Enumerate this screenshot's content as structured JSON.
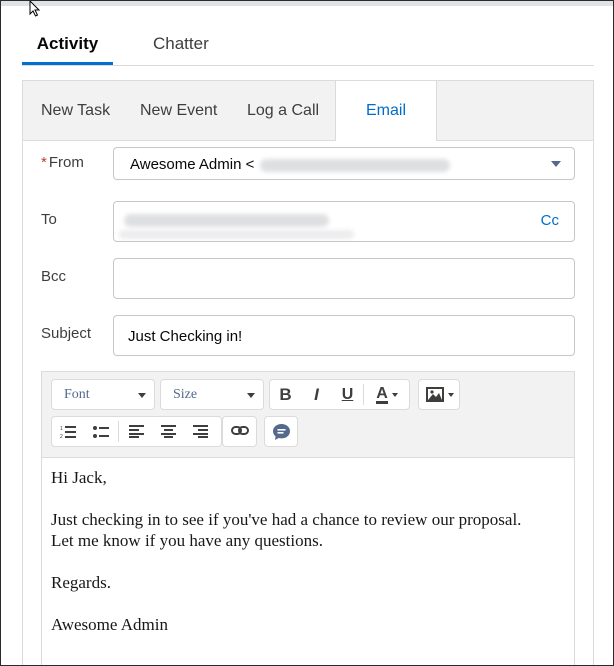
{
  "main_tabs": [
    {
      "label": "Activity",
      "active": true
    },
    {
      "label": "Chatter",
      "active": false
    }
  ],
  "publisher_tabs": [
    {
      "label": "New Task"
    },
    {
      "label": "New Event"
    },
    {
      "label": "Log a Call"
    },
    {
      "label": "Email",
      "active": true
    }
  ],
  "form": {
    "from_label": "From",
    "required_marker": "*",
    "from_value": "Awesome Admin <",
    "to_label": "To",
    "cc_label": "Cc",
    "bcc_label": "Bcc",
    "bcc_value": "",
    "subject_label": "Subject",
    "subject_value": "Just Checking in!"
  },
  "toolbar": {
    "font_label": "Font",
    "size_label": "Size",
    "bold_label": "B",
    "italic_label": "I",
    "underline_label": "U",
    "text_color_label": "A"
  },
  "email_body": {
    "greeting": "Hi Jack,",
    "line1": "Just checking in to see if you've had a chance to review our proposal.",
    "line2": "Let me know if you have any questions.",
    "closing": "Regards.",
    "signature": "Awesome Admin"
  },
  "colors": {
    "accent": "#0070d2",
    "link": "#006dcc",
    "required": "#c23934"
  }
}
